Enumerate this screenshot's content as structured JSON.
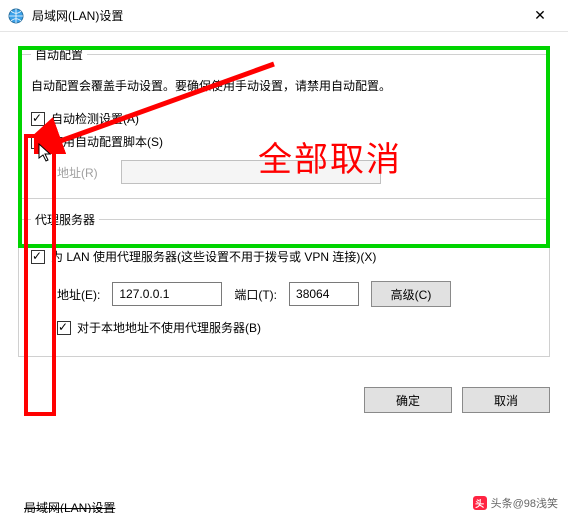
{
  "window": {
    "title": "局域网(LAN)设置",
    "close_glyph": "✕"
  },
  "auto_config": {
    "legend": "自动配置",
    "description": "自动配置会覆盖手动设置。要确保使用手动设置，请禁用自动配置。",
    "auto_detect": {
      "label": "自动检测设置(A)",
      "checked": true
    },
    "use_script": {
      "label": "使用自动配置脚本(S)",
      "checked": false
    },
    "address_label": "地址(R)",
    "address_value": ""
  },
  "proxy": {
    "legend": "代理服务器",
    "use_proxy": {
      "label": "为 LAN 使用代理服务器(这些设置不用于拨号或 VPN 连接)(X)",
      "checked": true
    },
    "address_label": "地址(E):",
    "address_value": "127.0.0.1",
    "port_label": "端口(T):",
    "port_value": "38064",
    "advanced_label": "高级(C)",
    "bypass_local": {
      "label": "对于本地地址不使用代理服务器(B)",
      "checked": true
    }
  },
  "buttons": {
    "ok": "确定",
    "cancel": "取消"
  },
  "annotation": {
    "text": "全部取消"
  },
  "watermark": "头条@98浅笑",
  "truncated_next": "局域网(LAN)设置"
}
